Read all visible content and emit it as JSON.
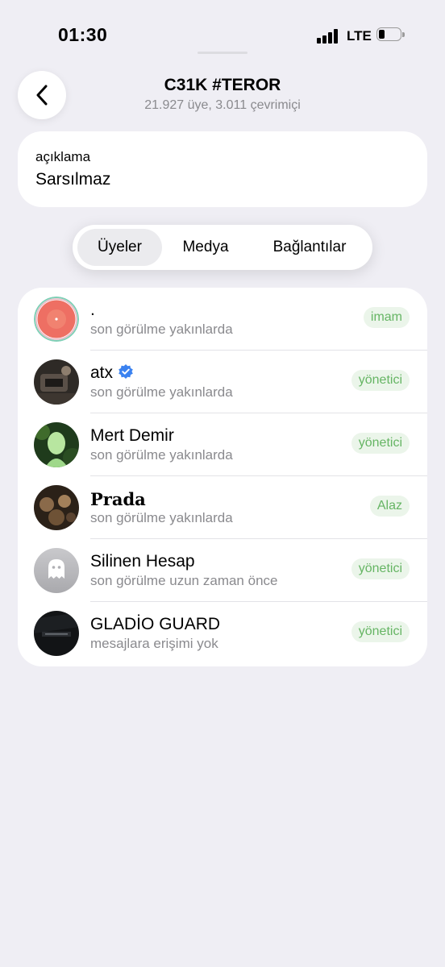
{
  "status_bar": {
    "time": "01:30",
    "network": "LTE"
  },
  "header": {
    "title": "C31K #TEROR",
    "subtitle": "21.927 üye, 3.011 çevrimiçi"
  },
  "description": {
    "label": "açıklama",
    "value": "Sarsılmaz"
  },
  "tabs": [
    {
      "label": "Üyeler",
      "active": true
    },
    {
      "label": "Medya",
      "active": false
    },
    {
      "label": "Bağlantılar",
      "active": false
    }
  ],
  "members": [
    {
      "name": ".",
      "status": "son görülme yakınlarda",
      "badge": "imam"
    },
    {
      "name": "atx",
      "status": "son görülme yakınlarda",
      "badge": "yönetici",
      "verified": true
    },
    {
      "name": "Mert Demir",
      "status": "son görülme yakınlarda",
      "badge": "yönetici"
    },
    {
      "name": "Prada",
      "status": "son görülme yakınlarda",
      "badge": "Alaz"
    },
    {
      "name": "Silinen Hesap",
      "status": "son görülme uzun zaman önce",
      "badge": "yönetici"
    },
    {
      "name": "GLADİO GUARD",
      "status": "mesajlara erişimi yok",
      "badge": "yönetici"
    }
  ],
  "colors": {
    "background": "#efeef4",
    "badge_text": "#66b564",
    "badge_bg": "#ebf5ea",
    "verified": "#3b82f0"
  }
}
